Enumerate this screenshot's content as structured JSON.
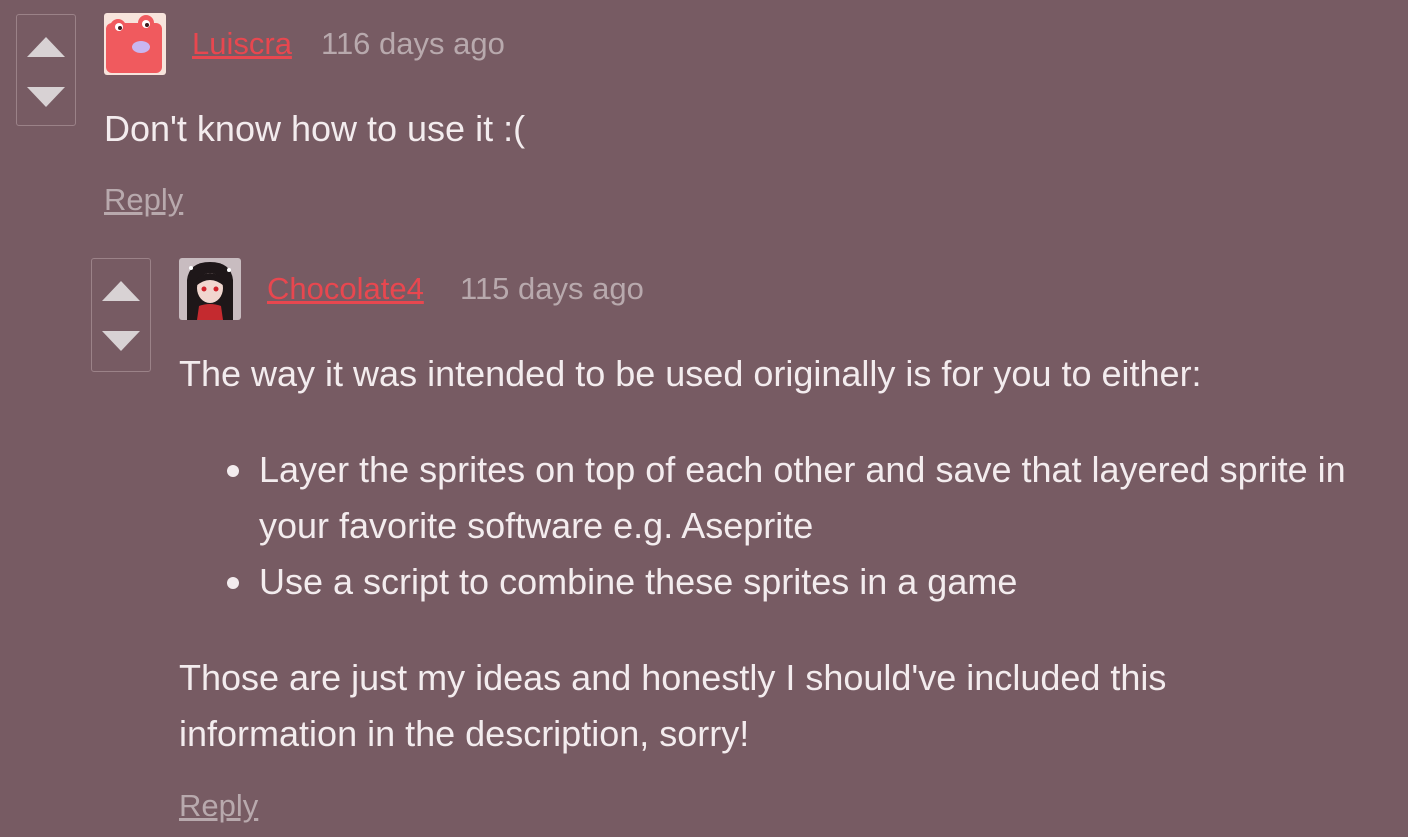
{
  "comments": [
    {
      "author": "Luiscra",
      "time": "116 days ago",
      "body": "Don't know how to use it :(",
      "reply_label": "Reply",
      "avatar": "pink-blob-avatar"
    },
    {
      "author": "Chocolate4",
      "time": "115 days ago",
      "intro": "The way it was intended to be used originally is for you to either:",
      "bullets": [
        "Layer the sprites on top of each other and save that layered sprite in your favorite software e.g. Aseprite",
        "Use a script to combine these sprites in a game"
      ],
      "closing_line1": "Those are just my ideas and honestly I should've included this",
      "closing_line2": "information in the description, sorry!",
      "reply_label": "Reply",
      "avatar": "anime-girl-avatar"
    }
  ],
  "colors": {
    "background": "#775b63",
    "author_link": "#e8474f",
    "muted": "#b8a9ad",
    "text": "#f3ecee"
  }
}
